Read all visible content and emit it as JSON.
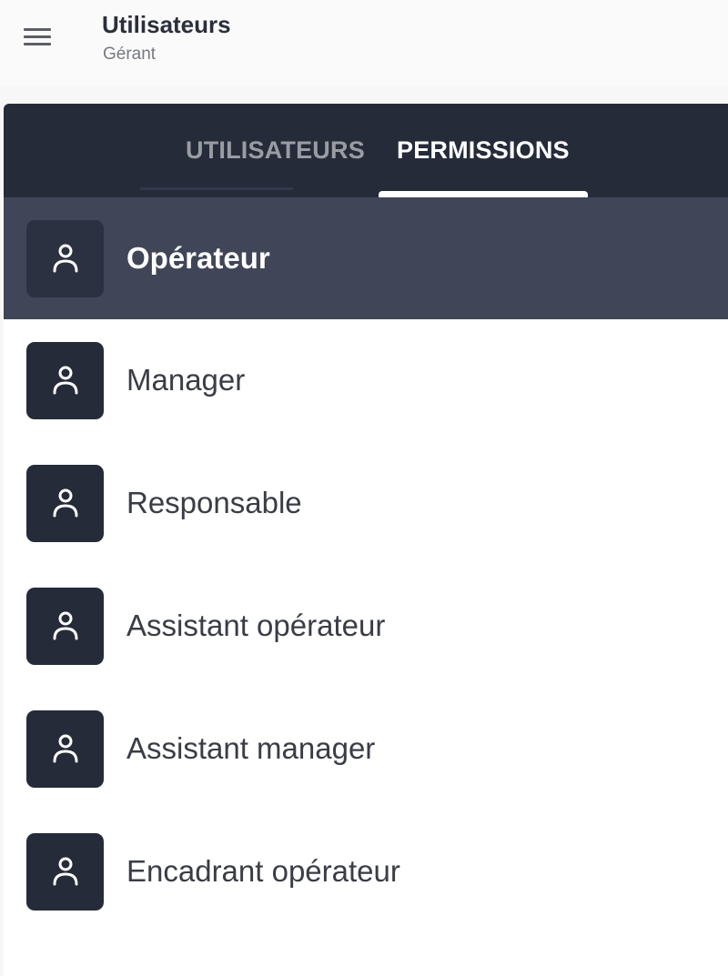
{
  "header": {
    "menu_icon": "hamburger-menu-icon",
    "title": "Utilisateurs",
    "subtitle": "Gérant"
  },
  "tabs": [
    {
      "label": "UTILISATEURS",
      "active": false
    },
    {
      "label": "PERMISSIONS",
      "active": true
    }
  ],
  "roles": [
    {
      "label": "Opérateur",
      "icon": "person-icon",
      "selected": true
    },
    {
      "label": "Manager",
      "icon": "person-icon",
      "selected": false
    },
    {
      "label": "Responsable",
      "icon": "person-icon",
      "selected": false
    },
    {
      "label": "Assistant opérateur",
      "icon": "person-icon",
      "selected": false
    },
    {
      "label": "Assistant manager",
      "icon": "person-icon",
      "selected": false
    },
    {
      "label": "Encadrant opérateur",
      "icon": "person-icon",
      "selected": false
    }
  ],
  "colors": {
    "dark_navy": "#262b3a",
    "selected_row": "#414558",
    "tab_active": "#ffffff",
    "tab_inactive": "#9a9ca3"
  }
}
